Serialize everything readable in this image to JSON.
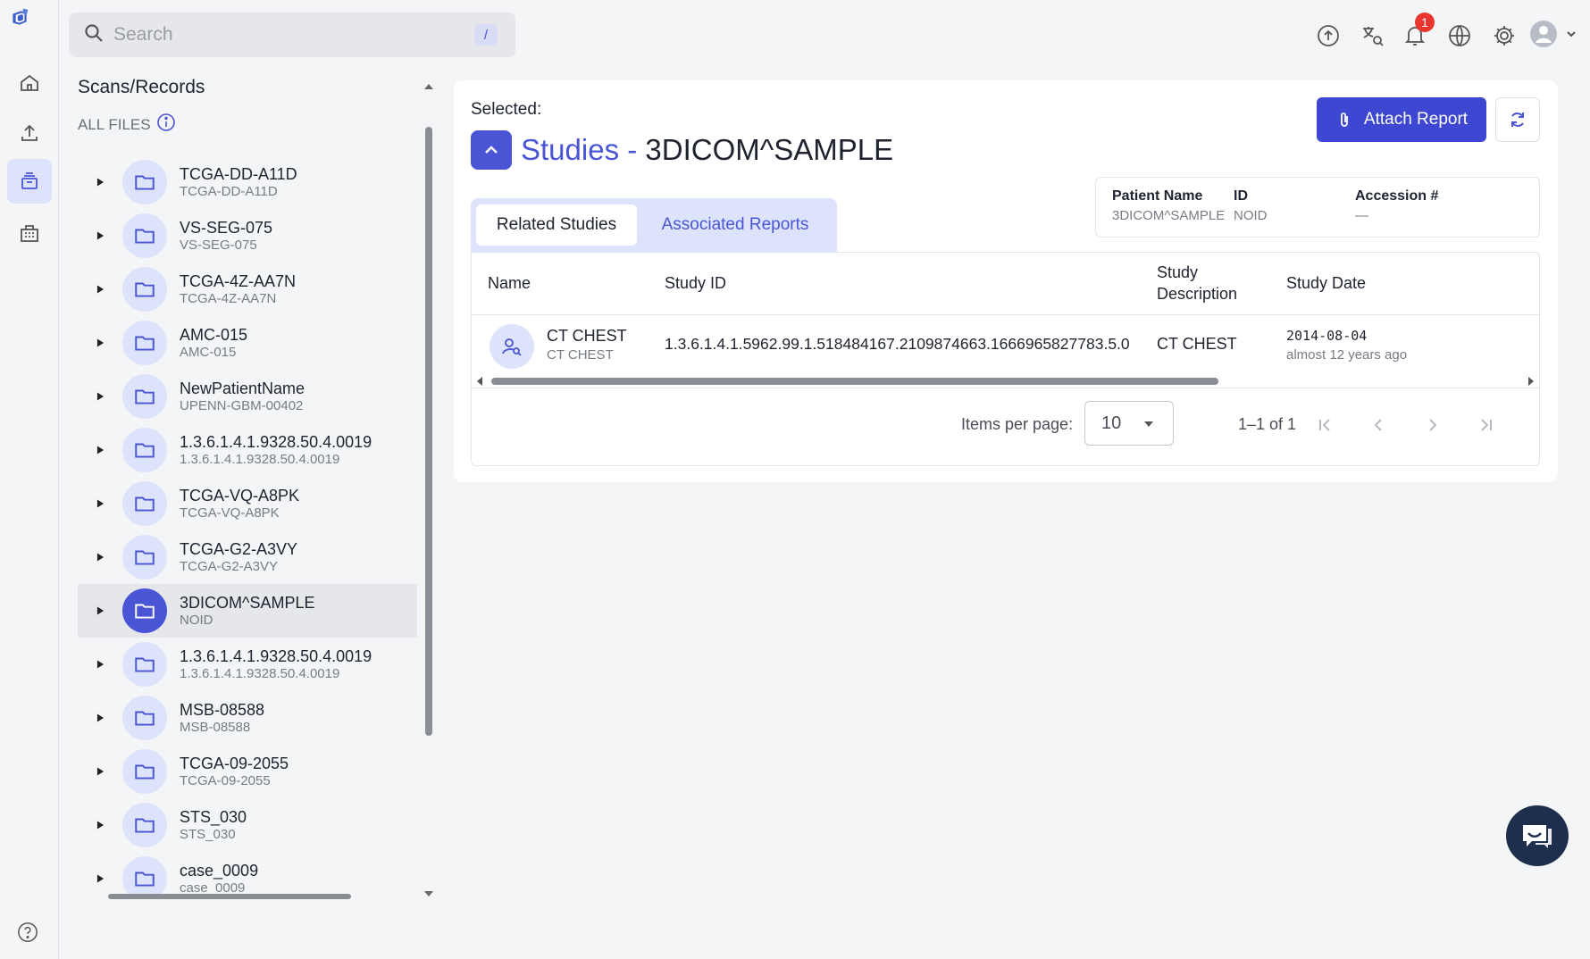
{
  "search": {
    "placeholder": "Search",
    "shortcut": "/"
  },
  "rail": {
    "items": [
      "home-icon",
      "upload-icon",
      "records-icon",
      "organization-icon"
    ],
    "active": "records-icon",
    "help_icon": "help-icon"
  },
  "topbar": {
    "icons": [
      "upload-cloud-icon",
      "translate-search-icon",
      "bell-icon",
      "globe-icon",
      "gear-icon",
      "user-avatar-icon"
    ],
    "notification_count": "1"
  },
  "tree": {
    "title": "Scans/Records",
    "all_files_label": "ALL FILES",
    "items": [
      {
        "name": "TCGA-DD-A11D",
        "sub": "TCGA-DD-A11D"
      },
      {
        "name": "VS-SEG-075",
        "sub": "VS-SEG-075"
      },
      {
        "name": "TCGA-4Z-AA7N",
        "sub": "TCGA-4Z-AA7N"
      },
      {
        "name": "AMC-015",
        "sub": "AMC-015"
      },
      {
        "name": "NewPatientName",
        "sub": "UPENN-GBM-00402"
      },
      {
        "name": "1.3.6.1.4.1.9328.50.4.0019",
        "sub": "1.3.6.1.4.1.9328.50.4.0019"
      },
      {
        "name": "TCGA-VQ-A8PK",
        "sub": "TCGA-VQ-A8PK"
      },
      {
        "name": "TCGA-G2-A3VY",
        "sub": "TCGA-G2-A3VY"
      },
      {
        "name": "3DICOM^SAMPLE",
        "sub": "NOID"
      },
      {
        "name": "1.3.6.1.4.1.9328.50.4.0019",
        "sub": "1.3.6.1.4.1.9328.50.4.0019"
      },
      {
        "name": "MSB-08588",
        "sub": "MSB-08588"
      },
      {
        "name": "TCGA-09-2055",
        "sub": "TCGA-09-2055"
      },
      {
        "name": "STS_030",
        "sub": "STS_030"
      },
      {
        "name": "case_0009",
        "sub": "case_0009"
      }
    ],
    "selected_index": 8
  },
  "main": {
    "selected_label": "Selected:",
    "studies_prefix": "Studies - ",
    "patient_title": "3DICOM^SAMPLE",
    "attach_label": "Attach Report",
    "meta": {
      "patient_name_label": "Patient Name",
      "patient_name": "3DICOM^SAMPLE",
      "id_label": "ID",
      "id": "NOID",
      "accession_label": "Accession #",
      "accession": "—"
    },
    "tabs": [
      {
        "label": "Related Studies"
      },
      {
        "label": "Associated Reports"
      }
    ],
    "active_tab": 0,
    "table": {
      "headers": {
        "name": "Name",
        "study_id": "Study ID",
        "description": "Study Description",
        "date": "Study Date"
      },
      "rows": [
        {
          "name": "CT CHEST",
          "sub": "CT CHEST",
          "study_id": "1.3.6.1.4.1.5962.99.1.518484167.2109874663.1666965827783.5.0",
          "description": "CT CHEST",
          "date": "2014-08-04",
          "date_relative": "almost 12 years ago"
        }
      ]
    },
    "pager": {
      "items_per_page_label": "Items per page:",
      "items_per_page": "10",
      "range": "1–1 of 1"
    }
  },
  "colors": {
    "accent": "#4a55d6",
    "accent_light": "#dde3fb",
    "badge": "#e8352e",
    "chat": "#1d2f4d"
  }
}
